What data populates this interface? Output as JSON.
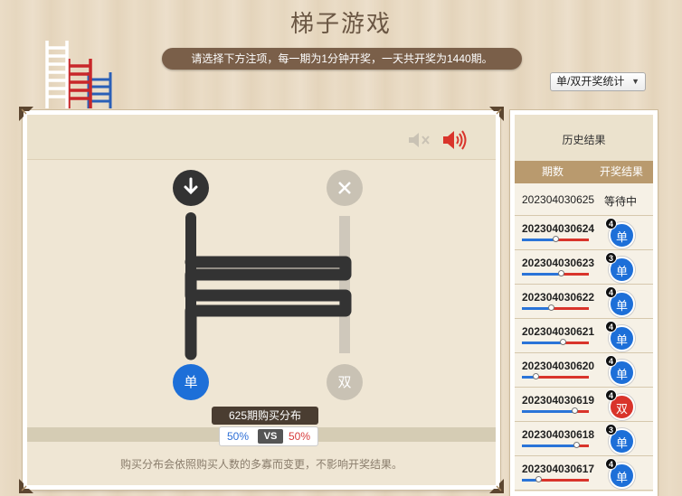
{
  "title": "梯子游戏",
  "notice": "请选择下方注项，每一期为1分钟开奖，一天共开奖为1440期。",
  "stat_select": {
    "value": "单/双开奖统计"
  },
  "game": {
    "start_left_icon": "down-arrow-icon",
    "start_right_icon": "close-icon",
    "result_left": "单",
    "result_right": "双",
    "dist_label": "625期购买分布",
    "dist_left": "50%",
    "dist_vs": "VS",
    "dist_right": "50%",
    "footer_note": "购买分布会依照购买人数的多寡而变更，不影响开奖结果。",
    "colors": {
      "single": "#1d6fd8",
      "double": "#d9342b",
      "ladder": "#333333"
    }
  },
  "history": {
    "title": "历史结果",
    "col_period": "期数",
    "col_result": "开奖结果",
    "pending": {
      "period": "202304030625",
      "status": "等待中"
    },
    "rows": [
      {
        "period": "202304030624",
        "result": "单",
        "badge": "4",
        "split": 0.52
      },
      {
        "period": "202304030623",
        "result": "单",
        "badge": "3",
        "split": 0.6
      },
      {
        "period": "202304030622",
        "result": "单",
        "badge": "4",
        "split": 0.45
      },
      {
        "period": "202304030621",
        "result": "单",
        "badge": "4",
        "split": 0.62
      },
      {
        "period": "202304030620",
        "result": "单",
        "badge": "4",
        "split": 0.22
      },
      {
        "period": "202304030619",
        "result": "双",
        "badge": "4",
        "split": 0.8
      },
      {
        "period": "202304030618",
        "result": "单",
        "badge": "3",
        "split": 0.82
      },
      {
        "period": "202304030617",
        "result": "单",
        "badge": "4",
        "split": 0.25
      }
    ]
  }
}
